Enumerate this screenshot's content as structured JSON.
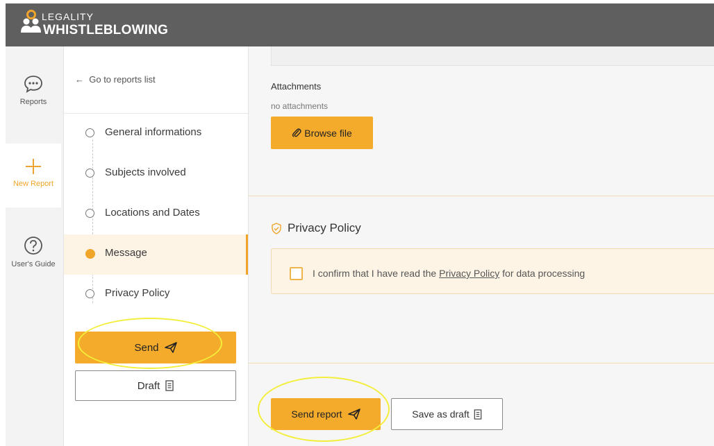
{
  "brand": {
    "line1": "LEGALITY",
    "line2": "WHISTLEBLOWING"
  },
  "nav": {
    "reports": "Reports",
    "new_report": "New Report",
    "users_guide": "User's Guide"
  },
  "steps": {
    "back": "Go to reports list",
    "items": [
      {
        "label": "General informations"
      },
      {
        "label": "Subjects involved"
      },
      {
        "label": "Locations and Dates"
      },
      {
        "label": "Message"
      },
      {
        "label": "Privacy Policy"
      }
    ],
    "active": "Message",
    "send_label": "Send",
    "draft_label": "Draft"
  },
  "main": {
    "attachments_label": "Attachments",
    "attachments_empty": "no attachments",
    "browse_label": "Browse file",
    "privacy": {
      "title": "Privacy Policy",
      "confirm_prefix": "I confirm that I have read the ",
      "confirm_link": "Privacy Policy",
      "confirm_suffix": " for data processing",
      "checked": false
    },
    "send_report_label": "Send report",
    "save_draft_label": "Save as draft"
  },
  "colors": {
    "accent": "#f4ab2c",
    "header": "#5f5f5f",
    "highlight": "#f3ee3a"
  }
}
